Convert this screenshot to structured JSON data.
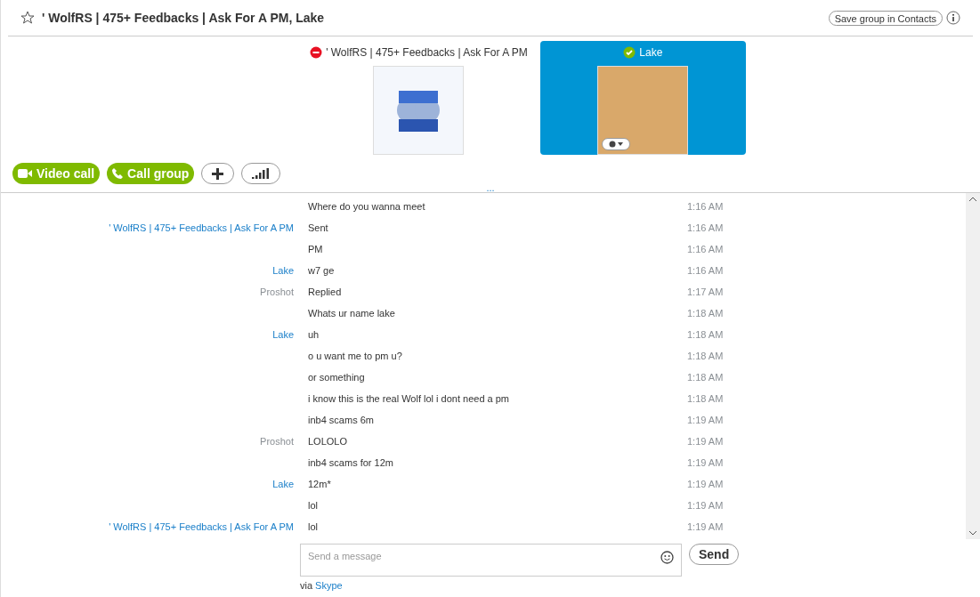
{
  "header": {
    "title": "' WolfRS | 475+ Feedbacks | Ask For A PM, Lake",
    "favorite": false,
    "save_button": "Save group in Contacts"
  },
  "participants": [
    {
      "name": "' WolfRS | 475+ Feedbacks | Ask For A PM",
      "online": false,
      "selected": false,
      "kind": "logo"
    },
    {
      "name": "Lake",
      "online": true,
      "selected": true,
      "kind": "photo"
    }
  ],
  "call_buttons": [
    "Video call",
    "Call group"
  ],
  "more": "...",
  "messages": [
    {
      "text": "Where do you wanna meet",
      "time": "1:16 AM"
    },
    {
      "sender": "' WolfRS | 475+ Feedbacks | Ask For A PM",
      "kind": "contact",
      "text": "Sent",
      "time": "1:16 AM"
    },
    {
      "text": "PM",
      "time": "1:16 AM"
    },
    {
      "sender": "Lake",
      "kind": "contact",
      "text": "w7 ge",
      "time": "1:16 AM"
    },
    {
      "sender": "Proshot",
      "kind": "self",
      "text": "Replied",
      "time": "1:17 AM"
    },
    {
      "text": "Whats ur name lake",
      "time": "1:18 AM"
    },
    {
      "sender": "Lake",
      "kind": "contact",
      "text": "uh",
      "time": "1:18 AM"
    },
    {
      "text": "o u want me to pm u?",
      "time": "1:18 AM"
    },
    {
      "text": "or something",
      "time": "1:18 AM"
    },
    {
      "text": "i know this is the real Wolf lol i dont need a pm",
      "time": "1:18 AM"
    },
    {
      "text": "inb4 scams 6m",
      "time": "1:19 AM"
    },
    {
      "sender": "Proshot",
      "kind": "self",
      "text": "LOLOLO",
      "time": "1:19 AM"
    },
    {
      "text": "inb4 scams for 12m",
      "time": "1:19 AM"
    },
    {
      "sender": "Lake",
      "kind": "contact",
      "text": "12m*",
      "time": "1:19 AM"
    },
    {
      "text": "lol",
      "time": "1:19 AM"
    },
    {
      "sender": "' WolfRS | 475+ Feedbacks | Ask For A PM",
      "kind": "contact",
      "text": "lol",
      "time": "1:19 AM"
    }
  ],
  "composer": {
    "placeholder": "Send a message",
    "send": "Send"
  },
  "via": {
    "label": "via",
    "service": "Skype"
  }
}
